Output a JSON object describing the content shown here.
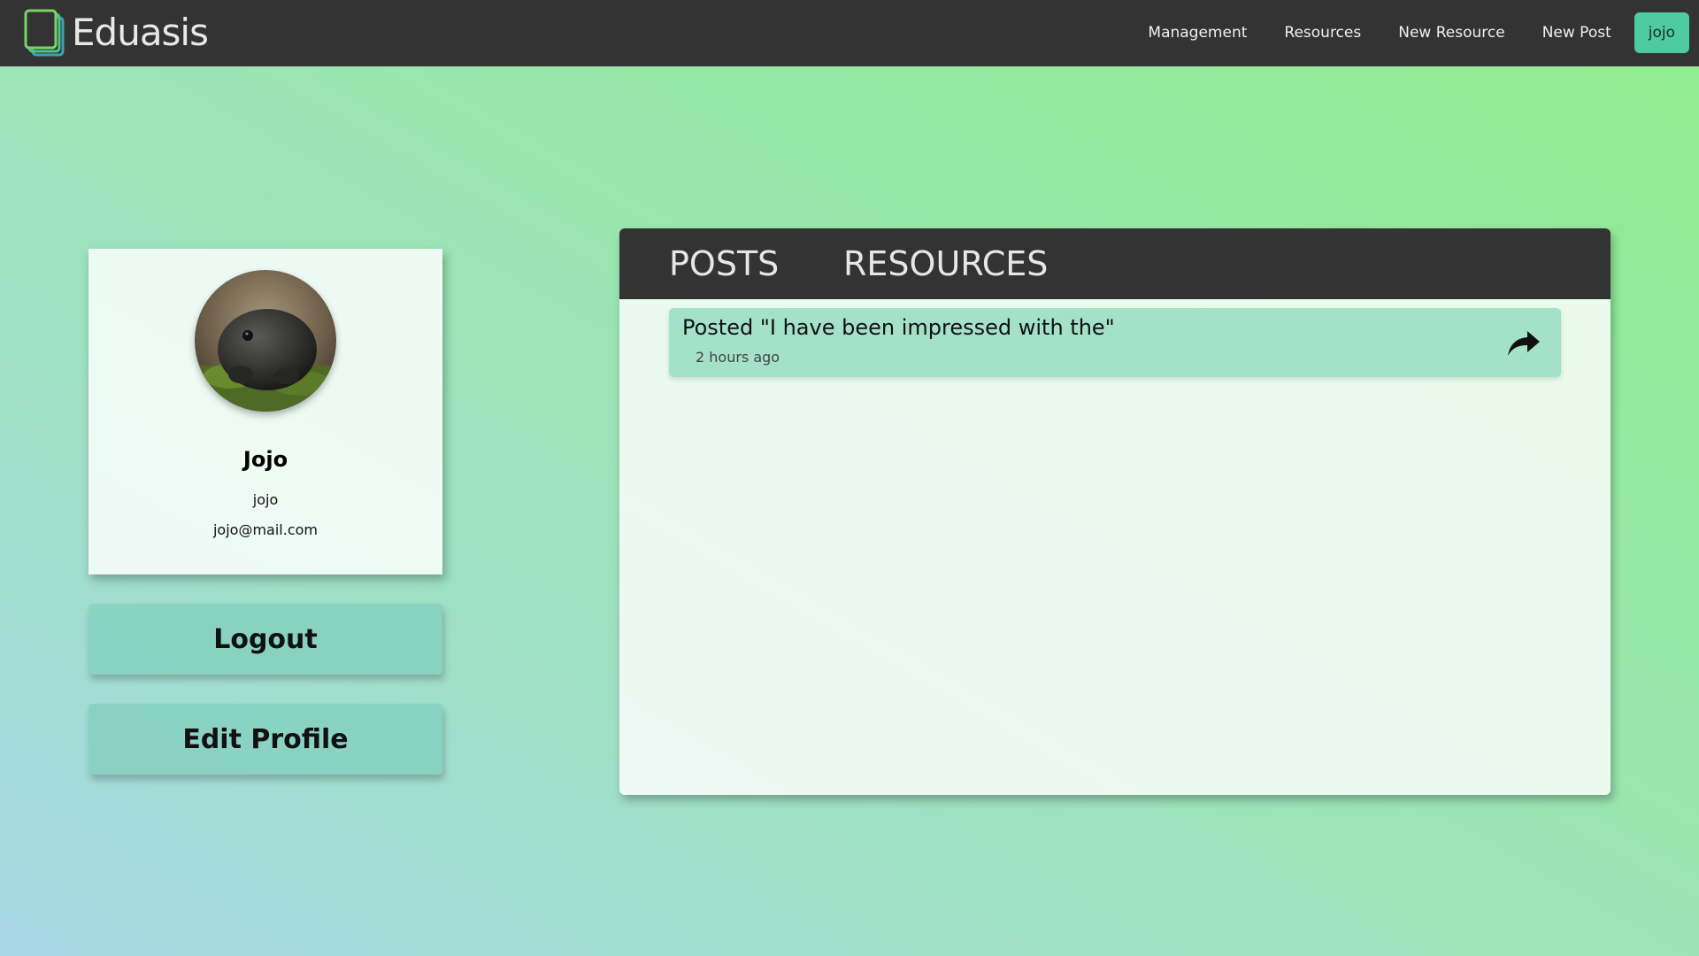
{
  "brand": {
    "name": "Eduasis",
    "logo_icon": "stacked-pages-logo"
  },
  "nav": {
    "items": [
      {
        "label": "Management"
      },
      {
        "label": "Resources"
      },
      {
        "label": "New Resource"
      },
      {
        "label": "New Post"
      }
    ],
    "user_label": "jojo"
  },
  "profile": {
    "avatar_icon": "frog-avatar",
    "display_name": "Jojo",
    "username": "jojo",
    "email": "jojo@mail.com"
  },
  "actions": {
    "logout_label": "Logout",
    "edit_profile_label": "Edit Profile"
  },
  "tabs": [
    {
      "label": "POSTS"
    },
    {
      "label": "RESOURCES"
    }
  ],
  "posts": [
    {
      "title": "Posted \"I have been impressed with the\"",
      "time": "2 hours ago",
      "action_icon": "share-arrow-icon"
    }
  ],
  "colors": {
    "navbar": "#333333",
    "accent": "#4ecba0",
    "button_bg": "#82cdbe",
    "post_bg": "#96dcc3"
  }
}
